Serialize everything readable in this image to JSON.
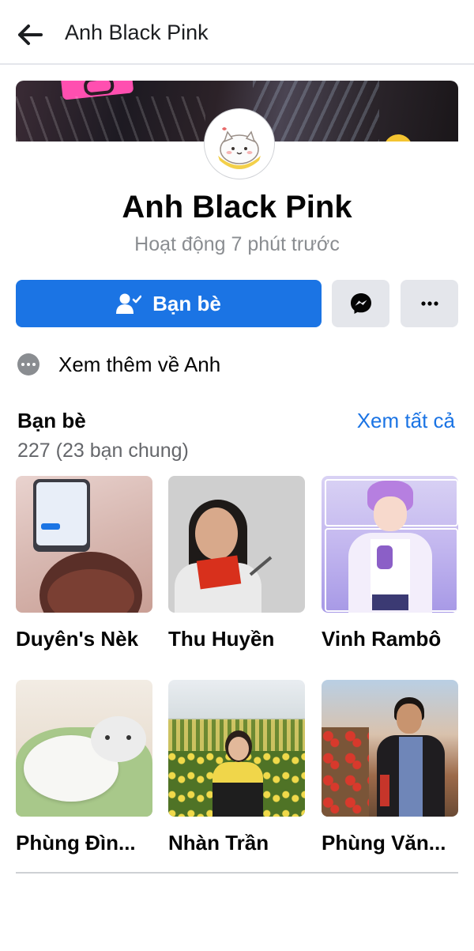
{
  "header": {
    "title": "Anh Black Pink",
    "back_icon": "arrow-left-icon"
  },
  "profile": {
    "name": "Anh Black Pink",
    "status": "Hoạt động 7 phút trước"
  },
  "actions": {
    "friends_label": "Bạn bè",
    "friends_icon": "friend-check-icon",
    "messenger_icon": "messenger-icon",
    "more_icon": "more-dots-icon",
    "primary_color": "#1b74e4"
  },
  "about": {
    "label": "Xem thêm về Anh",
    "icon": "more-dots-circle-icon"
  },
  "friends_section": {
    "title": "Bạn bè",
    "see_all": "Xem tất cả",
    "count": "227 (23 bạn chung)",
    "items": [
      {
        "name": "Duyên's Nèk"
      },
      {
        "name": "Thu Huyền"
      },
      {
        "name": "Vinh Rambô"
      },
      {
        "name": "Phùng Đìn..."
      },
      {
        "name": "Nhàn Trần"
      },
      {
        "name": "Phùng Văn..."
      }
    ]
  }
}
